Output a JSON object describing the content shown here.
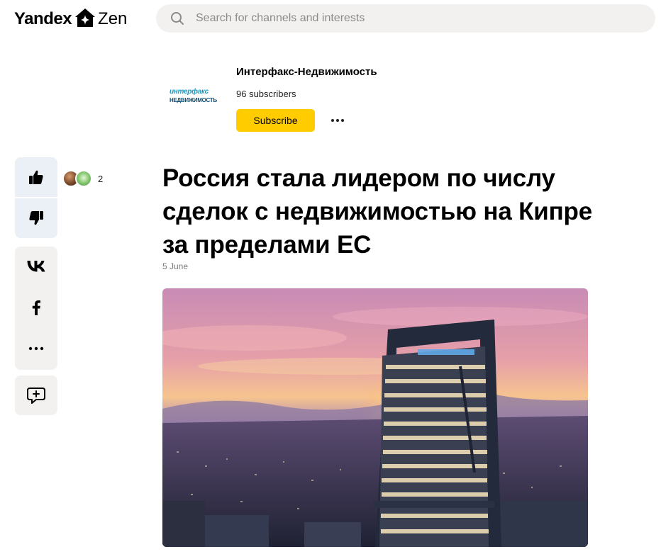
{
  "header": {
    "logo_left": "Yandex",
    "logo_right": "Zen",
    "search_placeholder": "Search for channels and interests"
  },
  "channel": {
    "name": "Интерфакс-Недвижимость",
    "subscribers": "96 subscribers",
    "subscribe_label": "Subscribe",
    "logo_line1": "интерфакс",
    "logo_line2": "НЕДВИЖИМОСТЬ"
  },
  "reactions": {
    "likes_count": "2"
  },
  "article": {
    "title": "Россия стала лидером по числу сделок с недвижимостью на Кипре за пределами ЕС",
    "date": "5 June"
  },
  "icons": [
    "search-icon",
    "zen-house-icon",
    "thumbs-up-icon",
    "thumbs-down-icon",
    "vk-icon",
    "facebook-icon",
    "more-icon",
    "add-comment-icon"
  ],
  "colors": {
    "accent": "#ffcc00",
    "panel_bg": "#f2f1ef",
    "reaction_bg": "#ebeff6"
  }
}
